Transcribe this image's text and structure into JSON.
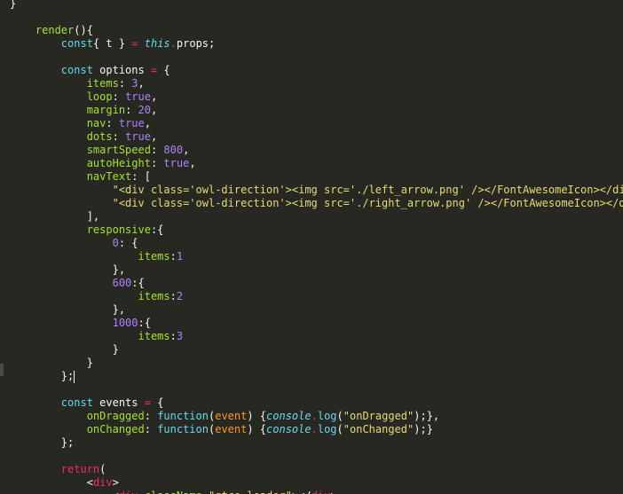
{
  "editor": {
    "lines": [
      {
        "tokens": [
          {
            "t": "}",
            "c": "punct"
          }
        ]
      },
      {
        "tokens": []
      },
      {
        "tokens": [
          {
            "t": "    ",
            "c": "default"
          },
          {
            "t": "render",
            "c": "function"
          },
          {
            "t": "(){",
            "c": "punct"
          }
        ]
      },
      {
        "tokens": [
          {
            "t": "        ",
            "c": "default"
          },
          {
            "t": "const",
            "c": "storage"
          },
          {
            "t": "{ t } ",
            "c": "default"
          },
          {
            "t": "=",
            "c": "operator"
          },
          {
            "t": " ",
            "c": "default"
          },
          {
            "t": "this",
            "c": "this"
          },
          {
            "t": ".",
            "c": "operator"
          },
          {
            "t": "props;",
            "c": "default"
          }
        ]
      },
      {
        "tokens": []
      },
      {
        "tokens": [
          {
            "t": "        ",
            "c": "default"
          },
          {
            "t": "const",
            "c": "storage"
          },
          {
            "t": " options ",
            "c": "default"
          },
          {
            "t": "=",
            "c": "operator"
          },
          {
            "t": " {",
            "c": "punct"
          }
        ]
      },
      {
        "tokens": [
          {
            "t": "            ",
            "c": "default"
          },
          {
            "t": "items",
            "c": "key"
          },
          {
            "t": ": ",
            "c": "punct"
          },
          {
            "t": "3",
            "c": "number"
          },
          {
            "t": ",",
            "c": "punct"
          }
        ]
      },
      {
        "tokens": [
          {
            "t": "            ",
            "c": "default"
          },
          {
            "t": "loop",
            "c": "key"
          },
          {
            "t": ": ",
            "c": "punct"
          },
          {
            "t": "true",
            "c": "constant"
          },
          {
            "t": ",",
            "c": "punct"
          }
        ]
      },
      {
        "tokens": [
          {
            "t": "            ",
            "c": "default"
          },
          {
            "t": "margin",
            "c": "key"
          },
          {
            "t": ": ",
            "c": "punct"
          },
          {
            "t": "20",
            "c": "number"
          },
          {
            "t": ",",
            "c": "punct"
          }
        ]
      },
      {
        "tokens": [
          {
            "t": "            ",
            "c": "default"
          },
          {
            "t": "nav",
            "c": "key"
          },
          {
            "t": ": ",
            "c": "punct"
          },
          {
            "t": "true",
            "c": "constant"
          },
          {
            "t": ",",
            "c": "punct"
          }
        ]
      },
      {
        "tokens": [
          {
            "t": "            ",
            "c": "default"
          },
          {
            "t": "dots",
            "c": "key"
          },
          {
            "t": ": ",
            "c": "punct"
          },
          {
            "t": "true",
            "c": "constant"
          },
          {
            "t": ",",
            "c": "punct"
          }
        ]
      },
      {
        "tokens": [
          {
            "t": "            ",
            "c": "default"
          },
          {
            "t": "smartSpeed",
            "c": "key"
          },
          {
            "t": ": ",
            "c": "punct"
          },
          {
            "t": "800",
            "c": "number"
          },
          {
            "t": ",",
            "c": "punct"
          }
        ]
      },
      {
        "tokens": [
          {
            "t": "            ",
            "c": "default"
          },
          {
            "t": "autoHeight",
            "c": "key"
          },
          {
            "t": ": ",
            "c": "punct"
          },
          {
            "t": "true",
            "c": "constant"
          },
          {
            "t": ",",
            "c": "punct"
          }
        ]
      },
      {
        "tokens": [
          {
            "t": "            ",
            "c": "default"
          },
          {
            "t": "navText",
            "c": "key"
          },
          {
            "t": ": [",
            "c": "punct"
          }
        ]
      },
      {
        "tokens": [
          {
            "t": "                ",
            "c": "default"
          },
          {
            "t": "\"<div class='owl-direction'><img src='./left_arrow.png' /></FontAwesomeIcon></div>\"",
            "c": "string"
          }
        ]
      },
      {
        "tokens": [
          {
            "t": "                ",
            "c": "default"
          },
          {
            "t": "\"<div class='owl-direction'><img src='./right_arrow.png' /></FontAwesomeIcon></div>\"",
            "c": "string"
          }
        ]
      },
      {
        "tokens": [
          {
            "t": "            ",
            "c": "default"
          },
          {
            "t": "],",
            "c": "punct"
          }
        ]
      },
      {
        "tokens": [
          {
            "t": "            ",
            "c": "default"
          },
          {
            "t": "responsive",
            "c": "key"
          },
          {
            "t": ":{",
            "c": "punct"
          }
        ]
      },
      {
        "tokens": [
          {
            "t": "                ",
            "c": "default"
          },
          {
            "t": "0",
            "c": "number"
          },
          {
            "t": ": {",
            "c": "punct"
          }
        ]
      },
      {
        "tokens": [
          {
            "t": "                    ",
            "c": "default"
          },
          {
            "t": "items",
            "c": "key"
          },
          {
            "t": ":",
            "c": "punct"
          },
          {
            "t": "1",
            "c": "number"
          }
        ]
      },
      {
        "tokens": [
          {
            "t": "                ",
            "c": "default"
          },
          {
            "t": "},",
            "c": "punct"
          }
        ]
      },
      {
        "tokens": [
          {
            "t": "                ",
            "c": "default"
          },
          {
            "t": "600",
            "c": "number"
          },
          {
            "t": ":{",
            "c": "punct"
          }
        ]
      },
      {
        "tokens": [
          {
            "t": "                    ",
            "c": "default"
          },
          {
            "t": "items",
            "c": "key"
          },
          {
            "t": ":",
            "c": "punct"
          },
          {
            "t": "2",
            "c": "number"
          }
        ]
      },
      {
        "tokens": [
          {
            "t": "                ",
            "c": "default"
          },
          {
            "t": "},",
            "c": "punct"
          }
        ]
      },
      {
        "tokens": [
          {
            "t": "                ",
            "c": "default"
          },
          {
            "t": "1000",
            "c": "number"
          },
          {
            "t": ":{",
            "c": "punct"
          }
        ]
      },
      {
        "tokens": [
          {
            "t": "                    ",
            "c": "default"
          },
          {
            "t": "items",
            "c": "key"
          },
          {
            "t": ":",
            "c": "punct"
          },
          {
            "t": "3",
            "c": "number"
          }
        ]
      },
      {
        "tokens": [
          {
            "t": "                ",
            "c": "default"
          },
          {
            "t": "}",
            "c": "punct"
          }
        ]
      },
      {
        "tokens": [
          {
            "t": "            ",
            "c": "default"
          },
          {
            "t": "}",
            "c": "punct"
          }
        ]
      },
      {
        "tokens": [
          {
            "t": "        ",
            "c": "default"
          },
          {
            "t": "};",
            "c": "punct"
          }
        ],
        "caret": true
      },
      {
        "tokens": []
      },
      {
        "tokens": [
          {
            "t": "        ",
            "c": "default"
          },
          {
            "t": "const",
            "c": "storage"
          },
          {
            "t": " events ",
            "c": "default"
          },
          {
            "t": "=",
            "c": "operator"
          },
          {
            "t": " {",
            "c": "punct"
          }
        ]
      },
      {
        "tokens": [
          {
            "t": "            ",
            "c": "default"
          },
          {
            "t": "onDragged",
            "c": "key"
          },
          {
            "t": ": ",
            "c": "punct"
          },
          {
            "t": "function",
            "c": "storage"
          },
          {
            "t": "(",
            "c": "punct"
          },
          {
            "t": "event",
            "c": "param"
          },
          {
            "t": ") {",
            "c": "punct"
          },
          {
            "t": "console",
            "c": "italic-class"
          },
          {
            "t": ".",
            "c": "operator"
          },
          {
            "t": "log",
            "c": "keyword"
          },
          {
            "t": "(",
            "c": "punct"
          },
          {
            "t": "\"onDragged\"",
            "c": "string"
          },
          {
            "t": ");},",
            "c": "punct"
          }
        ]
      },
      {
        "tokens": [
          {
            "t": "            ",
            "c": "default"
          },
          {
            "t": "onChanged",
            "c": "key"
          },
          {
            "t": ": ",
            "c": "punct"
          },
          {
            "t": "function",
            "c": "storage"
          },
          {
            "t": "(",
            "c": "punct"
          },
          {
            "t": "event",
            "c": "param"
          },
          {
            "t": ") {",
            "c": "punct"
          },
          {
            "t": "console",
            "c": "italic-class"
          },
          {
            "t": ".",
            "c": "operator"
          },
          {
            "t": "log",
            "c": "keyword"
          },
          {
            "t": "(",
            "c": "punct"
          },
          {
            "t": "\"onChanged\"",
            "c": "string"
          },
          {
            "t": ");}",
            "c": "punct"
          }
        ]
      },
      {
        "tokens": [
          {
            "t": "        ",
            "c": "default"
          },
          {
            "t": "};",
            "c": "punct"
          }
        ]
      },
      {
        "tokens": []
      },
      {
        "tokens": [
          {
            "t": "        ",
            "c": "default"
          },
          {
            "t": "return",
            "c": "return"
          },
          {
            "t": "(",
            "c": "punct"
          }
        ]
      },
      {
        "tokens": [
          {
            "t": "            ",
            "c": "default"
          },
          {
            "t": "<",
            "c": "punct"
          },
          {
            "t": "div",
            "c": "tag"
          },
          {
            "t": ">",
            "c": "punct"
          }
        ]
      },
      {
        "tokens": [
          {
            "t": "                ",
            "c": "default"
          },
          {
            "t": "<",
            "c": "punct"
          },
          {
            "t": "div",
            "c": "tag"
          },
          {
            "t": " ",
            "c": "default"
          },
          {
            "t": "className",
            "c": "attr"
          },
          {
            "t": "=",
            "c": "operator"
          },
          {
            "t": "\"gtco-loader\"",
            "c": "string"
          },
          {
            "t": "></",
            "c": "punct"
          },
          {
            "t": "div",
            "c": "tag"
          },
          {
            "t": ">",
            "c": "punct"
          }
        ]
      }
    ]
  },
  "colors": {
    "background": "#272822",
    "default": "#f8f8f2",
    "keyword": "#66d9ef",
    "function": "#a6e22e",
    "operator": "#f92672",
    "string": "#e6db74",
    "number": "#ae81ff",
    "param": "#fd971f"
  }
}
